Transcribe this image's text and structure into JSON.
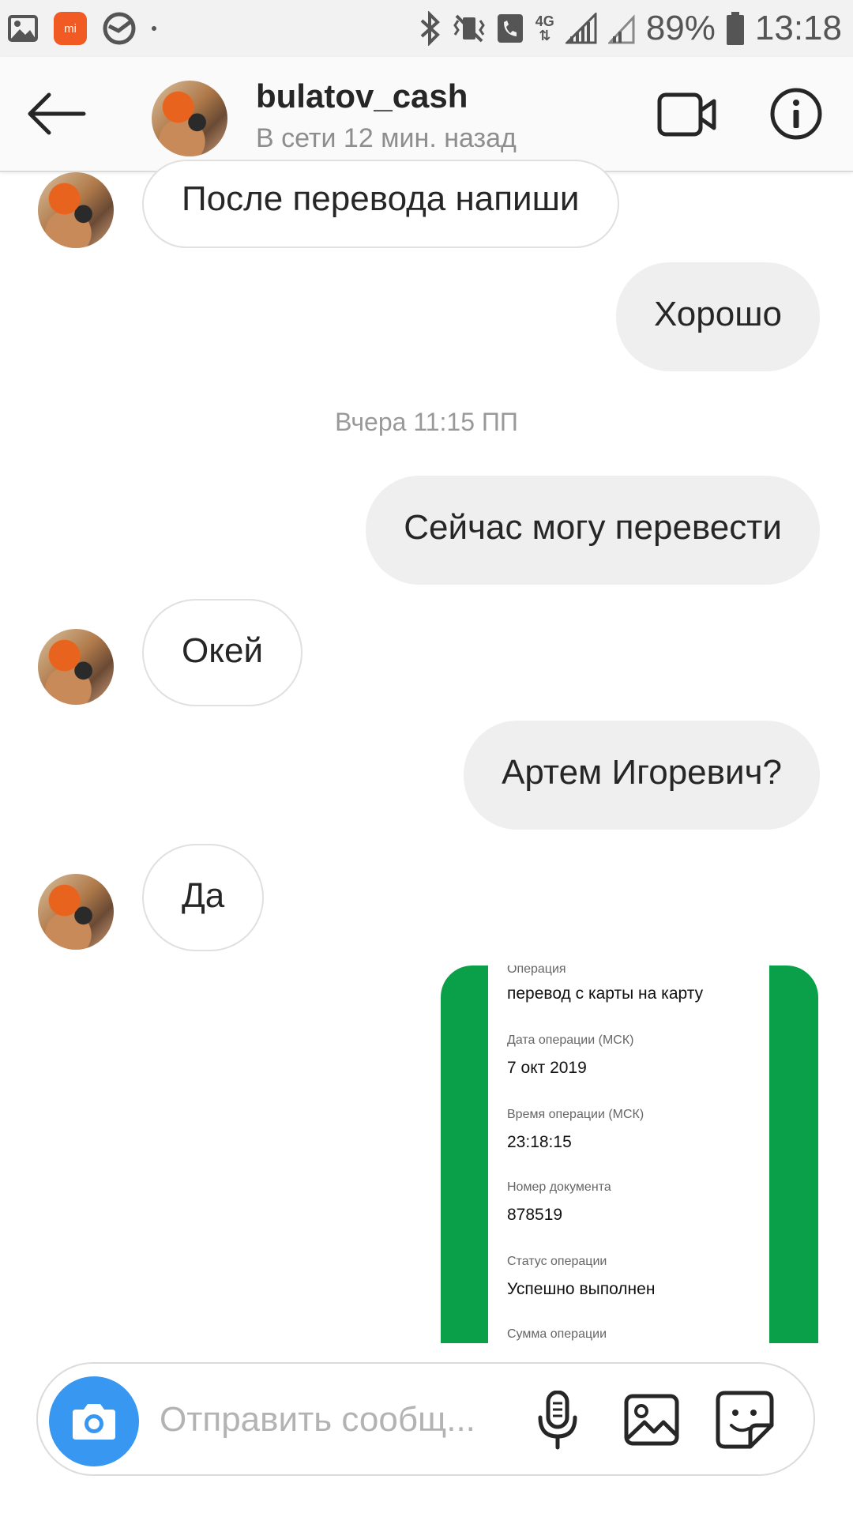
{
  "status_bar": {
    "battery_percent": "89%",
    "time": "13:18",
    "network": "4G",
    "left_icons": [
      "gallery-icon",
      "mi-icon",
      "sberbank-icon",
      "dot-icon"
    ],
    "right_icons": [
      "bluetooth-icon",
      "vibrate-icon",
      "phone-icon",
      "signal-icon",
      "signal-weak-icon",
      "battery-icon"
    ]
  },
  "header": {
    "username": "bulatov_cash",
    "status": "В сети 12 мин. назад"
  },
  "messages": [
    {
      "side": "in",
      "text": "После перевода напиши"
    },
    {
      "side": "out",
      "text": "Хорошо"
    },
    {
      "side": "out",
      "text": "Сейчас могу перевести"
    },
    {
      "side": "in",
      "text": "Окей"
    },
    {
      "side": "out",
      "text": "Артем Игоревич?"
    },
    {
      "side": "in",
      "text": "Да"
    }
  ],
  "timestamp": "Вчера 11:15 ПП",
  "receipt": {
    "cut_label": "Операция",
    "operation": "перевод с карты на карту",
    "date_label": "Дата операции (МСК)",
    "date": "7 окт 2019",
    "time_label": "Время операции (МСК)",
    "time": "23:18:15",
    "doc_label": "Номер документа",
    "doc": "878519",
    "status_label": "Статус операции",
    "status": "Успешно выполнен",
    "sum_label": "Сумма операции"
  },
  "composer": {
    "placeholder": "Отправить сообщ..."
  },
  "colors": {
    "camera_blue": "#3897f0",
    "receipt_green": "#0aa04a",
    "bubble_out": "#efefef"
  }
}
